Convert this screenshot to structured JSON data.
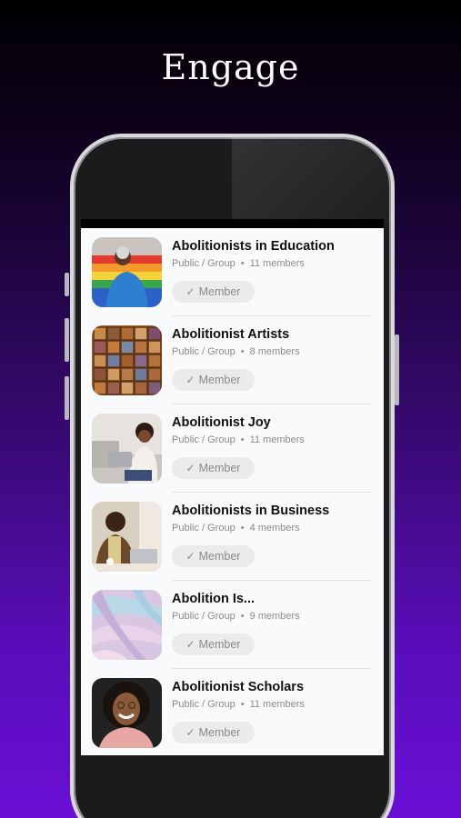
{
  "headline": "Engage",
  "groups": [
    {
      "name": "Abolitionists in Education",
      "type": "Public / Group",
      "members": "11 members",
      "button": "Member",
      "thumb": "person-pride-flag"
    },
    {
      "name": "Abolitionist Artists",
      "type": "Public / Group",
      "members": "8 members",
      "button": "Member",
      "thumb": "mosaic-tiles"
    },
    {
      "name": "Abolitionist Joy",
      "type": "Public / Group",
      "members": "11 members",
      "button": "Member",
      "thumb": "woman-with-laptop"
    },
    {
      "name": "Abolitionists in Business",
      "type": "Public / Group",
      "members": "4 members",
      "button": "Member",
      "thumb": "man-at-desk"
    },
    {
      "name": "Abolition Is...",
      "type": "Public / Group",
      "members": "9 members",
      "button": "Member",
      "thumb": "marble-pastel"
    },
    {
      "name": "Abolitionist Scholars",
      "type": "Public / Group",
      "members": "11 members",
      "button": "Member",
      "thumb": "smiling-woman"
    }
  ],
  "colors": {
    "background_top": "#000000",
    "background_bottom": "#6a10d6",
    "screen": "#f9fafb",
    "button_bg": "#ebebed"
  }
}
